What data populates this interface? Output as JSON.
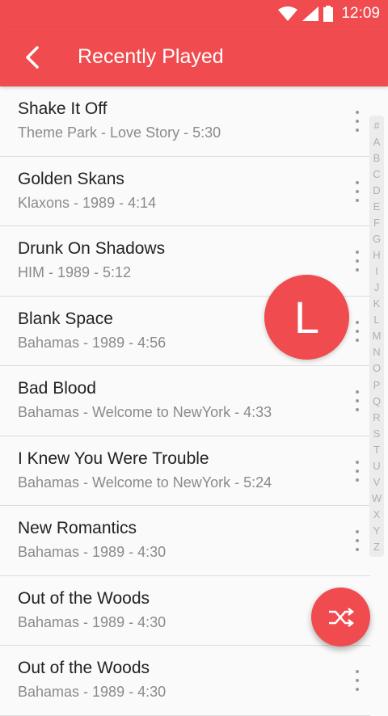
{
  "status": {
    "time": "12:09"
  },
  "app_bar": {
    "title": "Recently Played"
  },
  "songs": [
    {
      "title": "Shake It Off",
      "subtitle": "Theme Park - Love Story - 5:30"
    },
    {
      "title": "Golden Skans",
      "subtitle": "Klaxons - 1989 - 4:14"
    },
    {
      "title": "Drunk On Shadows",
      "subtitle": "HIM - 1989 - 5:12"
    },
    {
      "title": "Blank Space",
      "subtitle": "Bahamas - 1989 - 4:56"
    },
    {
      "title": "Bad Blood",
      "subtitle": "Bahamas - Welcome to NewYork - 4:33"
    },
    {
      "title": "I Knew You Were Trouble",
      "subtitle": "Bahamas - Welcome to NewYork - 5:24"
    },
    {
      "title": "New Romantics",
      "subtitle": "Bahamas - 1989 - 4:30"
    },
    {
      "title": "Out of the Woods",
      "subtitle": "Bahamas - 1989 - 4:30"
    },
    {
      "title": "Out of the Woods",
      "subtitle": "Bahamas - 1989 - 4:30"
    }
  ],
  "index_letters": [
    "#",
    "A",
    "B",
    "C",
    "D",
    "E",
    "F",
    "G",
    "H",
    "I",
    "J",
    "K",
    "L",
    "M",
    "N",
    "O",
    "P",
    "Q",
    "R",
    "S",
    "T",
    "U",
    "V",
    "W",
    "X",
    "Y",
    "Z"
  ],
  "active_letter": "L",
  "colors": {
    "accent": "#f04b4f",
    "title_text": "#222222",
    "subtitle_text": "#8a8a8a"
  },
  "icons": {
    "back": "arrow-back-icon",
    "wifi": "wifi-icon",
    "signal": "signal-icon",
    "battery": "battery-icon",
    "more": "more-vert-icon",
    "shuffle": "shuffle-icon"
  }
}
